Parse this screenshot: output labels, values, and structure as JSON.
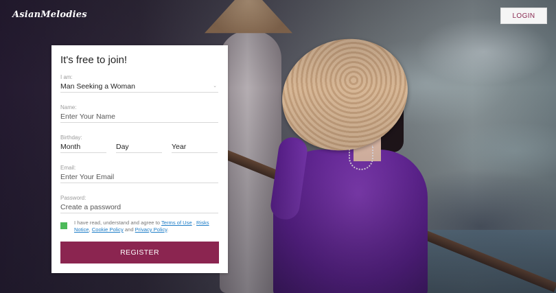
{
  "header": {
    "logo_text": "AsianMelodies",
    "login_label": "LOGIN"
  },
  "form": {
    "title": "It's free to join!",
    "iam": {
      "label": "I am:",
      "value": "Man Seeking a Woman"
    },
    "name": {
      "label": "Name:",
      "placeholder": "Enter Your Name"
    },
    "birthday": {
      "label": "Birthday:",
      "month": "Month",
      "day": "Day",
      "year": "Year"
    },
    "email": {
      "label": "Email:",
      "placeholder": "Enter Your Email"
    },
    "password": {
      "label": "Password:",
      "placeholder": "Create a password"
    },
    "consent": {
      "checked": true,
      "prefix": "I have read, understand and agree to ",
      "terms": "Terms of Use",
      "sep1": " , ",
      "risks": "Risks Notice",
      "sep2": ", ",
      "cookie": "Cookie Policy",
      "sep3": " and ",
      "privacy": "Privacy Policy",
      "suffix": "."
    },
    "register_label": "REGISTER"
  },
  "colors": {
    "brand": "#8b2550",
    "checkbox": "#4cba5a",
    "link": "#1c7cc7"
  }
}
